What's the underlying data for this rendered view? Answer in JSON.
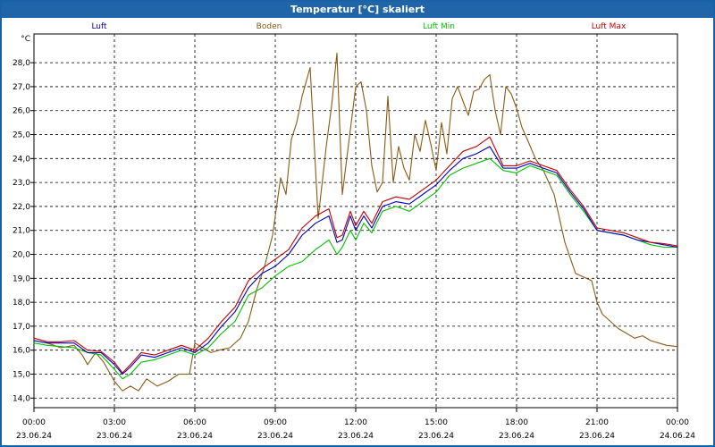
{
  "window": {
    "title": "Temperatur [°C] skaliert"
  },
  "colors": {
    "titlebar": "#1f65a8",
    "grid": "#000000"
  },
  "chart_data": {
    "type": "line",
    "title": "Temperatur [°C] skaliert",
    "ylabel": "°C",
    "xlabel": "",
    "ylim": [
      13.6,
      29.2
    ],
    "xlim": [
      0,
      24
    ],
    "grid": true,
    "legend_position": "top",
    "yticks": [
      "14,0",
      "15,0",
      "16,0",
      "17,0",
      "18,0",
      "19,0",
      "20,0",
      "21,0",
      "22,0",
      "23,0",
      "24,0",
      "25,0",
      "26,0",
      "27,0",
      "28,0"
    ],
    "ytick_values": [
      14,
      15,
      16,
      17,
      18,
      19,
      20,
      21,
      22,
      23,
      24,
      25,
      26,
      27,
      28
    ],
    "xtick_times": [
      "00:00",
      "03:00",
      "06:00",
      "09:00",
      "12:00",
      "15:00",
      "18:00",
      "21:00",
      "00:00"
    ],
    "xtick_dates": [
      "23.06.24",
      "23.06.24",
      "23.06.24",
      "23.06.24",
      "23.06.24",
      "23.06.24",
      "23.06.24",
      "23.06.24",
      "24.06.24"
    ],
    "xtick_values": [
      0,
      3,
      6,
      9,
      12,
      15,
      18,
      21,
      24
    ],
    "series": [
      {
        "name": "Boden",
        "color": "#8b5a14",
        "x": [
          0,
          0.5,
          1,
          1.5,
          1.8,
          2,
          2.3,
          2.6,
          3,
          3.3,
          3.6,
          3.9,
          4.2,
          4.6,
          5,
          5.4,
          5.8,
          6,
          6.3,
          6.6,
          6.9,
          7.3,
          7.7,
          8,
          8.3,
          8.6,
          8.9,
          9.2,
          9.4,
          9.6,
          9.8,
          10,
          10.3,
          10.6,
          10.9,
          11.1,
          11.3,
          11.5,
          11.8,
          12,
          12.2,
          12.4,
          12.6,
          12.8,
          13,
          13.2,
          13.4,
          13.6,
          13.8,
          14,
          14.2,
          14.4,
          14.6,
          14.8,
          15,
          15.2,
          15.4,
          15.6,
          15.8,
          16,
          16.2,
          16.4,
          16.6,
          16.8,
          17,
          17.2,
          17.4,
          17.6,
          17.8,
          18,
          18.2,
          18.4,
          18.7,
          19,
          19.4,
          19.8,
          20.2,
          20.6,
          20.8,
          21,
          21.2,
          21.5,
          21.8,
          22.1,
          22.4,
          22.7,
          23,
          23.3,
          23.6,
          24
        ],
        "values": [
          16.4,
          16.3,
          16.1,
          16.2,
          15.8,
          15.4,
          15.9,
          15.5,
          14.7,
          14.3,
          14.5,
          14.3,
          14.8,
          14.5,
          14.7,
          15.0,
          15.0,
          16.3,
          16.1,
          15.9,
          16.0,
          16.1,
          16.5,
          17.2,
          18.5,
          19.5,
          20.8,
          23.2,
          22.5,
          24.8,
          25.5,
          26.6,
          27.8,
          21.5,
          24.5,
          26.2,
          28.4,
          22.5,
          25.2,
          27.0,
          27.2,
          26.0,
          23.7,
          22.6,
          23.0,
          26.6,
          23.0,
          24.5,
          23.6,
          23.1,
          25.0,
          24.3,
          25.6,
          24.6,
          23.5,
          25.5,
          24.2,
          26.5,
          27.0,
          26.4,
          25.8,
          26.8,
          26.9,
          27.3,
          27.5,
          26.0,
          25.0,
          27.0,
          26.7,
          26.1,
          25.3,
          24.8,
          24.0,
          23.5,
          22.5,
          20.5,
          19.2,
          19.0,
          18.9,
          18.0,
          17.5,
          17.2,
          16.9,
          16.7,
          16.5,
          16.6,
          16.4,
          16.3,
          16.2,
          16.15
        ]
      },
      {
        "name": "Luft Min",
        "color": "#00c000",
        "x": [
          0,
          0.5,
          1,
          1.5,
          2,
          2.5,
          3,
          3.3,
          3.6,
          4,
          4.5,
          5,
          5.5,
          6,
          6.5,
          7,
          7.5,
          8,
          8.5,
          9,
          9.5,
          10,
          10.5,
          11,
          11.3,
          11.5,
          11.8,
          12,
          12.3,
          12.6,
          13,
          13.5,
          14,
          14.5,
          15,
          15.5,
          16,
          16.5,
          17,
          17.5,
          18,
          18.5,
          19,
          19.5,
          20,
          20.5,
          21,
          21.5,
          22,
          22.5,
          23,
          23.5,
          24
        ],
        "values": [
          16.3,
          16.2,
          16.15,
          16.1,
          15.9,
          15.8,
          15.2,
          14.8,
          15.0,
          15.5,
          15.6,
          15.8,
          16.0,
          15.8,
          16.1,
          16.7,
          17.2,
          18.3,
          18.6,
          19.1,
          19.5,
          19.7,
          20.2,
          20.6,
          20.0,
          20.3,
          21.0,
          20.6,
          21.3,
          20.9,
          21.8,
          22.0,
          21.8,
          22.2,
          22.6,
          23.3,
          23.6,
          23.8,
          24.0,
          23.5,
          23.4,
          23.7,
          23.5,
          23.3,
          22.5,
          21.8,
          21.0,
          20.9,
          20.8,
          20.6,
          20.4,
          20.3,
          20.3
        ]
      },
      {
        "name": "Luft",
        "color": "#0000c0",
        "x": [
          0,
          0.5,
          1,
          1.5,
          2,
          2.5,
          3,
          3.3,
          3.6,
          4,
          4.5,
          5,
          5.5,
          6,
          6.5,
          7,
          7.5,
          8,
          8.5,
          9,
          9.5,
          10,
          10.5,
          11,
          11.3,
          11.5,
          11.8,
          12,
          12.3,
          12.6,
          13,
          13.5,
          14,
          14.5,
          15,
          15.5,
          16,
          16.5,
          17,
          17.5,
          18,
          18.5,
          19,
          19.5,
          20,
          20.5,
          21,
          21.5,
          22,
          22.5,
          23,
          23.5,
          24
        ],
        "values": [
          16.4,
          16.3,
          16.3,
          16.3,
          15.9,
          15.9,
          15.4,
          15.0,
          15.3,
          15.8,
          15.7,
          15.9,
          16.1,
          15.9,
          16.3,
          17.0,
          17.6,
          18.6,
          19.2,
          19.5,
          20.0,
          20.8,
          21.3,
          21.6,
          20.5,
          20.6,
          21.6,
          21.0,
          21.6,
          21.1,
          22.0,
          22.2,
          22.1,
          22.5,
          22.9,
          23.5,
          24.0,
          24.2,
          24.5,
          23.6,
          23.6,
          23.8,
          23.6,
          23.4,
          22.6,
          21.9,
          21.0,
          20.9,
          20.8,
          20.6,
          20.5,
          20.4,
          20.3
        ]
      },
      {
        "name": "Luft Max",
        "color": "#c00000",
        "x": [
          0,
          0.5,
          1,
          1.5,
          2,
          2.5,
          3,
          3.3,
          3.6,
          4,
          4.5,
          5,
          5.5,
          6,
          6.5,
          7,
          7.5,
          8,
          8.5,
          9,
          9.5,
          10,
          10.5,
          11,
          11.3,
          11.5,
          11.8,
          12,
          12.3,
          12.6,
          13,
          13.5,
          14,
          14.5,
          15,
          15.5,
          16,
          16.5,
          17,
          17.5,
          18,
          18.5,
          19,
          19.5,
          20,
          20.5,
          21,
          21.5,
          22,
          22.5,
          23,
          23.5,
          24
        ],
        "values": [
          16.5,
          16.35,
          16.35,
          16.4,
          16.0,
          15.95,
          15.5,
          15.05,
          15.4,
          15.9,
          15.8,
          16.0,
          16.2,
          16.0,
          16.5,
          17.2,
          17.8,
          18.9,
          19.4,
          19.8,
          20.2,
          21.1,
          21.6,
          21.9,
          20.7,
          20.8,
          21.8,
          21.2,
          21.8,
          21.3,
          22.2,
          22.4,
          22.3,
          22.7,
          23.1,
          23.7,
          24.3,
          24.5,
          24.9,
          23.7,
          23.7,
          23.9,
          23.7,
          23.5,
          22.7,
          22.0,
          21.1,
          21.0,
          20.9,
          20.7,
          20.5,
          20.45,
          20.35
        ]
      }
    ]
  }
}
